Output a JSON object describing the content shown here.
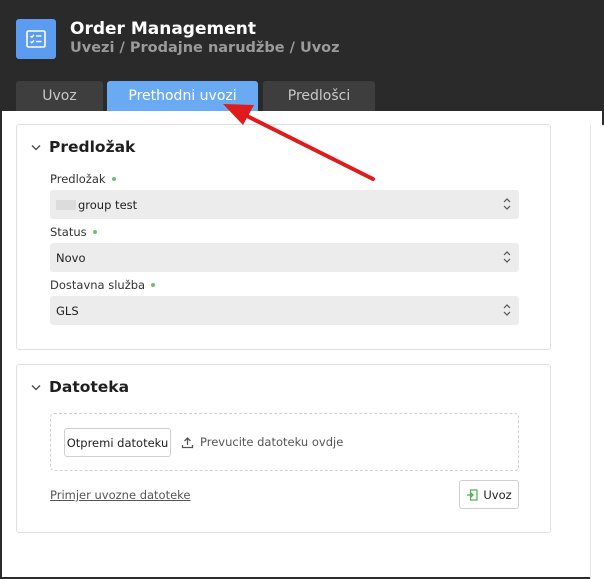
{
  "header": {
    "app_icon": "checklist-icon",
    "title": "Order Management",
    "breadcrumb": "Uvezi / Prodajne narudžbe / Uvoz"
  },
  "tabs": [
    {
      "label": "Uvoz",
      "active": false
    },
    {
      "label": "Prethodni uvozi",
      "active": true
    },
    {
      "label": "Predlošci",
      "active": false
    }
  ],
  "template_section": {
    "title": "Predložak",
    "fields": [
      {
        "label": "Predložak",
        "value": "group test"
      },
      {
        "label": "Status",
        "value": "Novo"
      },
      {
        "label": "Dostavna služba",
        "value": "GLS"
      }
    ]
  },
  "file_section": {
    "title": "Datoteka",
    "upload_button": "Otpremi datoteku",
    "drop_hint": "Prevucite datoteku ovdje",
    "example_link": "Primjer uvozne datoteke",
    "import_button": "Uvoz"
  },
  "colors": {
    "accent": "#6aaaf3",
    "header_bg": "#2a2a2a",
    "required_dot": "#6cc070",
    "annotation_arrow": "#e01b1b"
  }
}
